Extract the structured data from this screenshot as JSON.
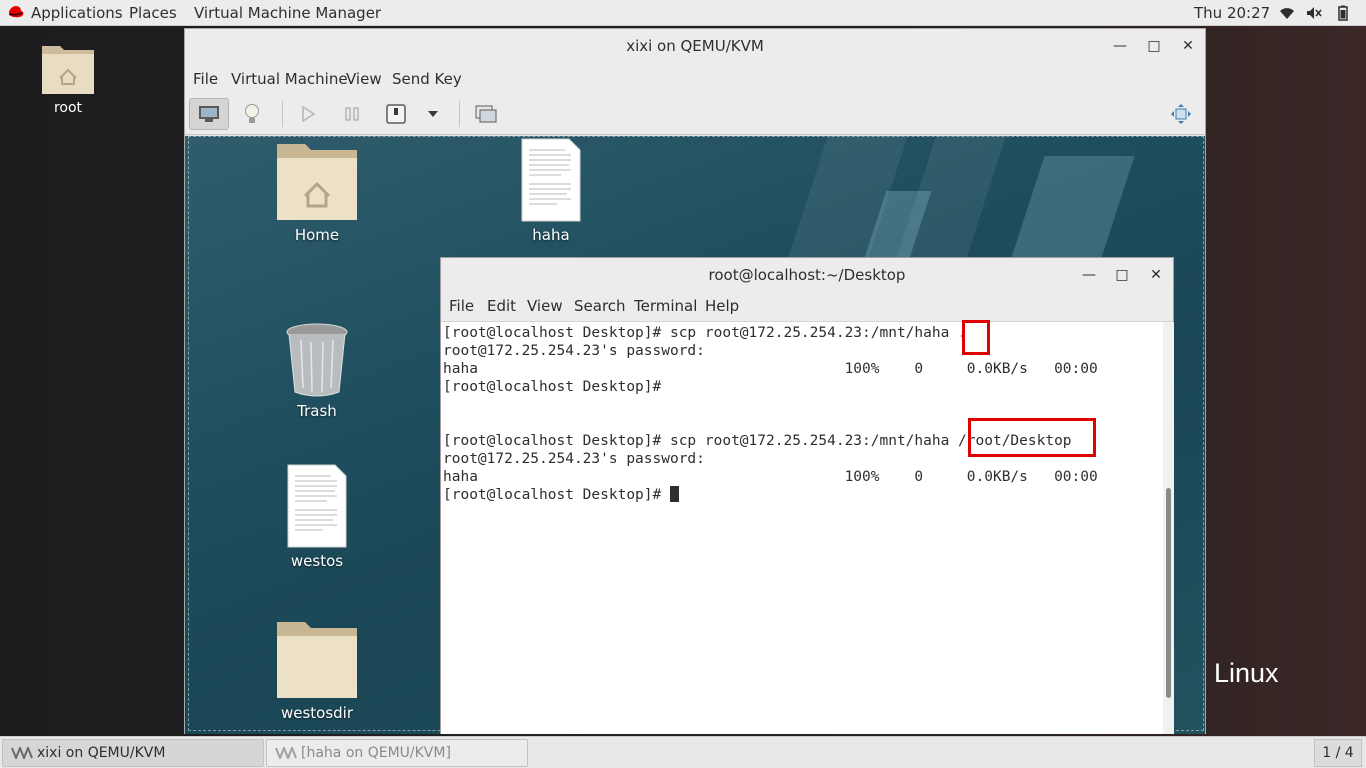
{
  "topbar": {
    "applications": "Applications",
    "places": "Places",
    "app_name": "Virtual Machine Manager",
    "clock": "Thu 20:27"
  },
  "host_desktop": {
    "icons": [
      {
        "label": "root",
        "icon": "folder-home-icon"
      }
    ],
    "wallpaper_text": "Linux"
  },
  "vm_window": {
    "title": "xixi on QEMU/KVM",
    "menu": [
      "File",
      "Virtual Machine",
      "View",
      "Send Key"
    ],
    "toolbar": [
      "console-icon",
      "details-lightbulb-icon",
      "run-icon",
      "pause-icon",
      "shutdown-icon",
      "dropdown-icon",
      "screenshot-icon",
      "fullscreen-icon"
    ]
  },
  "guest_desktop": {
    "icons": [
      {
        "label": "Home",
        "icon": "folder-home-icon"
      },
      {
        "label": "haha",
        "icon": "text-file-icon"
      },
      {
        "label": "Trash",
        "icon": "trash-icon"
      },
      {
        "label": "westos",
        "icon": "text-file-icon"
      },
      {
        "label": "westosdir",
        "icon": "folder-icon"
      }
    ]
  },
  "terminal": {
    "title": "root@localhost:~/Desktop",
    "menu": [
      "File",
      "Edit",
      "View",
      "Search",
      "Terminal",
      "Help"
    ],
    "lines": [
      "[root@localhost Desktop]# scp root@172.25.254.23:/mnt/haha .",
      "root@172.25.254.23's password: ",
      "haha                                          100%    0     0.0KB/s   00:00    ",
      "[root@localhost Desktop]# ",
      "",
      "",
      "[root@localhost Desktop]# scp root@172.25.254.23:/mnt/haha /root/Desktop",
      "root@172.25.254.23's password: ",
      "haha                                          100%    0     0.0KB/s   00:00    ",
      "[root@localhost Desktop]# "
    ],
    "highlight_color": "#e00000"
  },
  "taskbar": {
    "tasks": [
      {
        "label": "xixi on QEMU/KVM",
        "active": true
      },
      {
        "label": "[haha on QEMU/KVM]",
        "active": false
      }
    ],
    "workspace": "1 / 4"
  }
}
